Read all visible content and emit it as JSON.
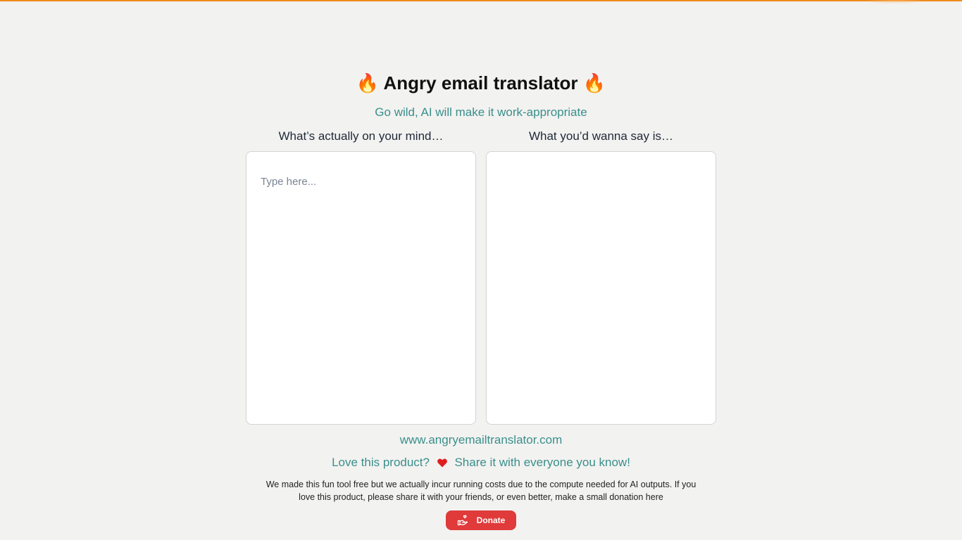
{
  "header": {
    "title": "Angry email translator",
    "title_icon": "fire-icon",
    "title_emoji": "🔥",
    "subtitle": "Go wild, AI will make it work-appropriate"
  },
  "input_panel": {
    "label": "What’s actually on your mind…",
    "placeholder": "Type here...",
    "value": ""
  },
  "output_panel": {
    "label": "What you’d wanna say is…",
    "value": ""
  },
  "footer": {
    "site_url": "www.angryemailtranslator.com",
    "love_prefix": "Love this product?",
    "love_suffix": "Share it with everyone you know!",
    "heart_icon": "heart-icon",
    "note": "We made this fun tool free but we actually incur running costs due to the compute needed for AI outputs. If you love this product, please share it with your friends, or even better, make a small donation here",
    "donate_label": "Donate",
    "donate_icon": "hand-heart-icon"
  },
  "colors": {
    "background": "#f2f2f1",
    "top_bar": "#f08a1c",
    "accent_teal": "#3a8f8a",
    "heart": "#e01e1e",
    "donate_button": "#e03a3a"
  }
}
